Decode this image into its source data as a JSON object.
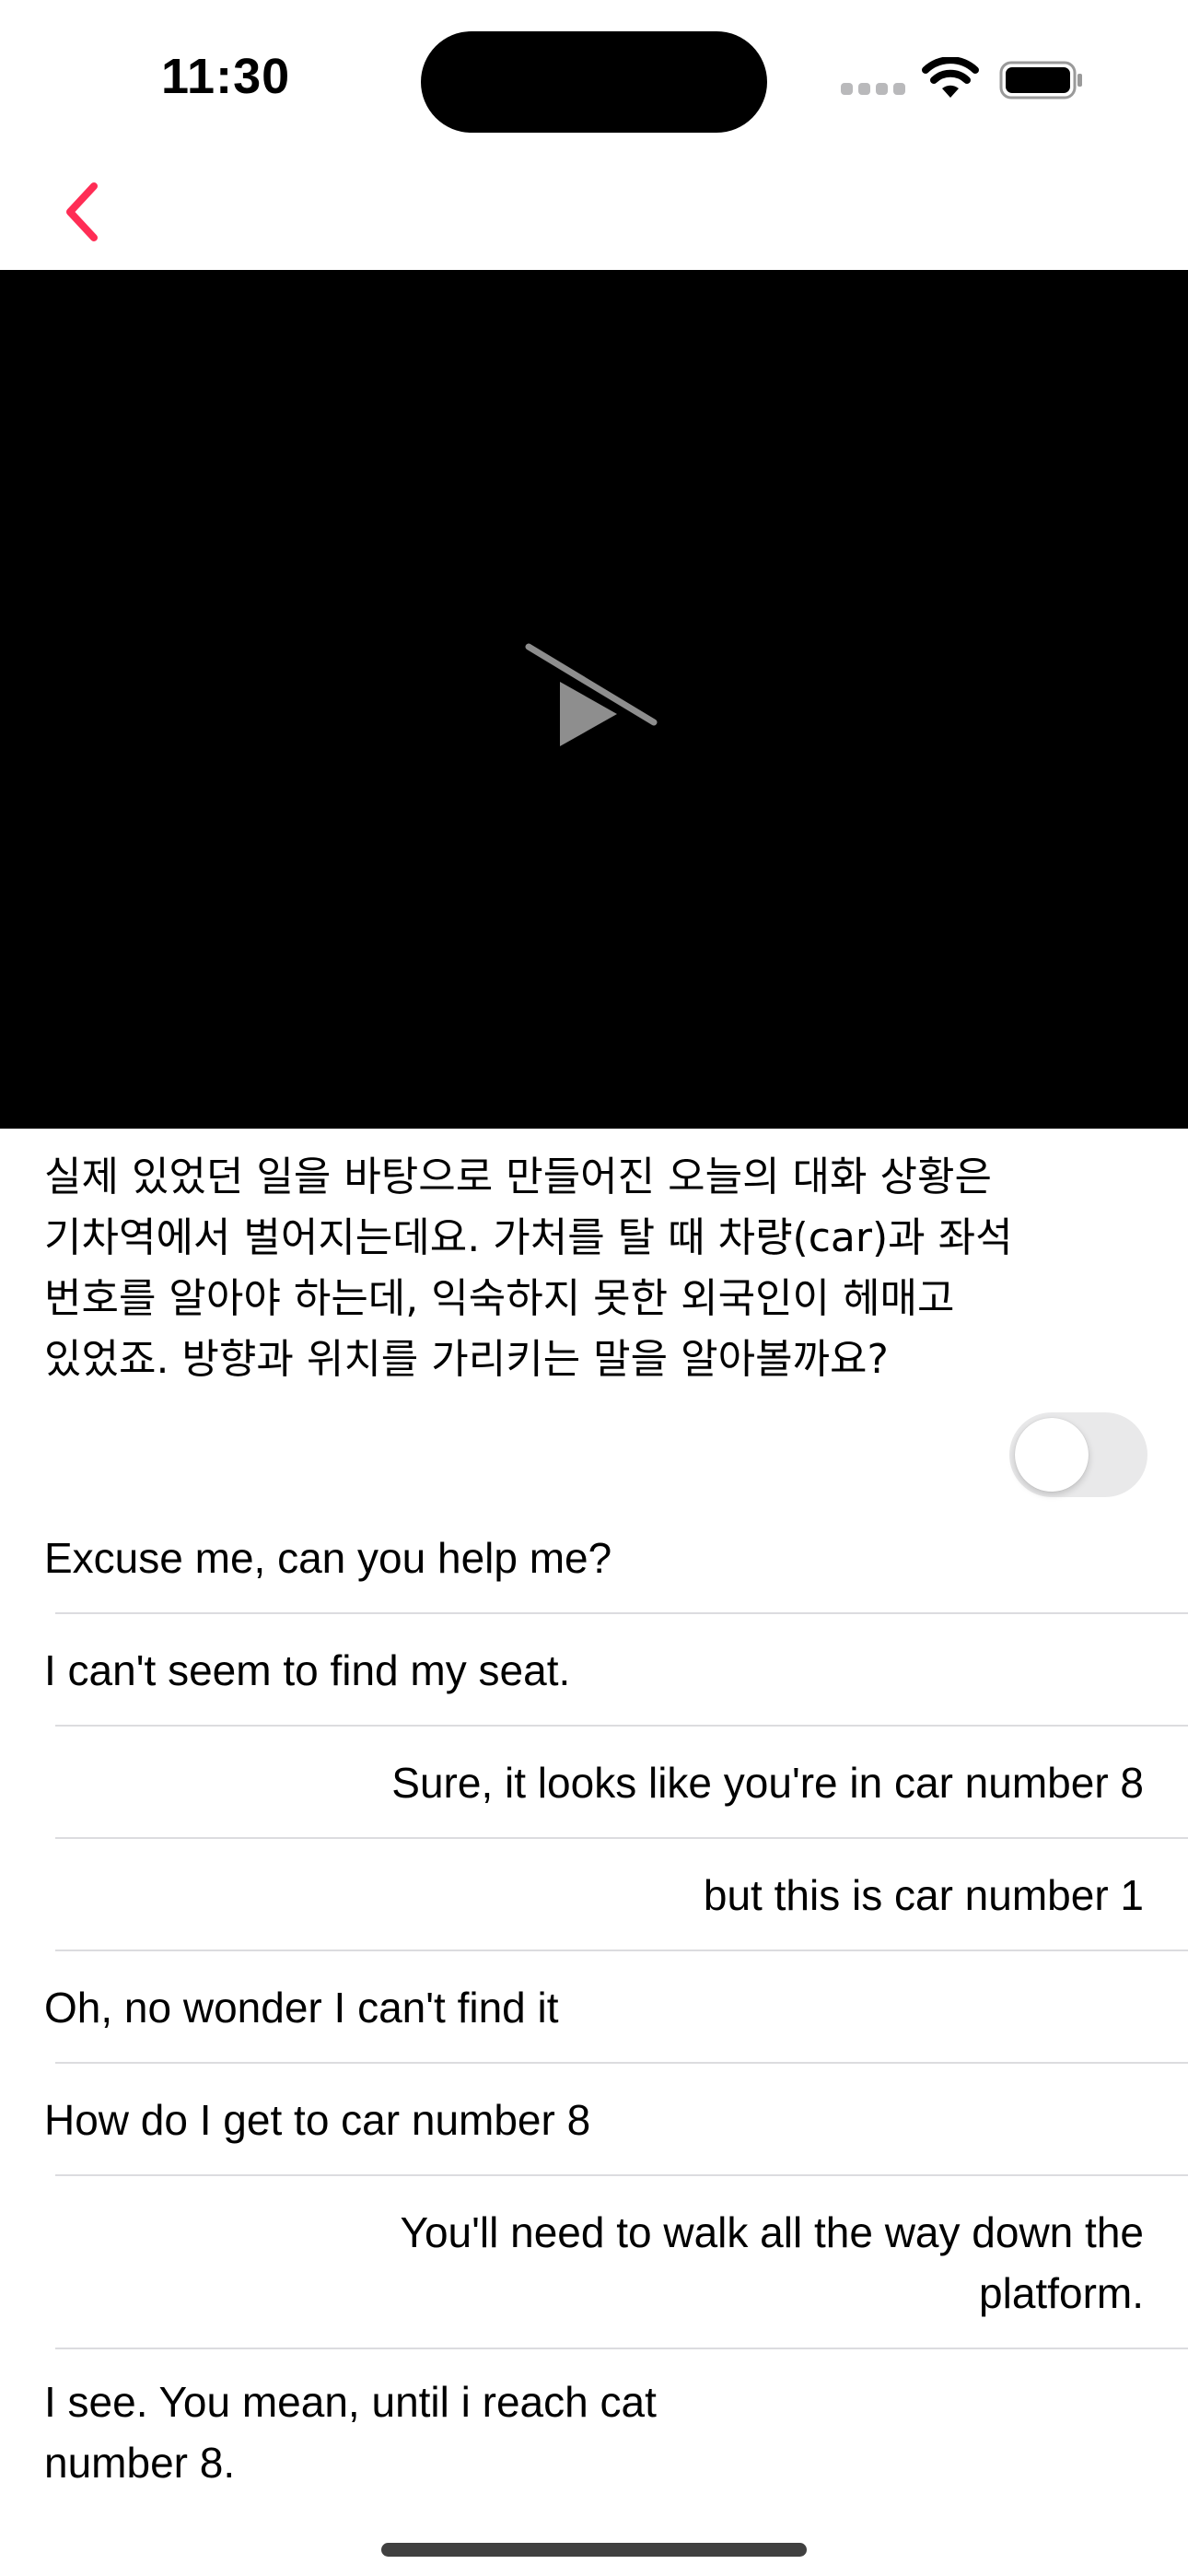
{
  "status_bar": {
    "time": "11:30",
    "signal_icon": "cellular-signal-icon",
    "wifi_icon": "wifi-icon",
    "battery_icon": "battery-icon"
  },
  "nav": {
    "back_icon": "chevron-left-icon",
    "accent_color": "#ff2d55"
  },
  "video": {
    "state_icon": "play-slash-icon"
  },
  "description_lines": [
    "실제 있었던 일을 바탕으로 만들어진 오늘의 대화 상황은",
    "기차역에서 벌어지는데요. 가처를 탈 때 차량(car)과 좌석",
    "번호를 알아야 하는데, 익숙하지 못한 외국인이 헤매고",
    "있었죠. 방향과 위치를 가리키는 말을 알아볼까요?"
  ],
  "toggle": {
    "on": false
  },
  "dialogue": [
    {
      "text": "Excuse me, can you help me?",
      "align": "left"
    },
    {
      "text": "I can't seem to find my seat.",
      "align": "left"
    },
    {
      "text": "Sure, it looks like you're in car number 8",
      "align": "right"
    },
    {
      "text": "but this is car number 1",
      "align": "right"
    },
    {
      "text": "Oh, no wonder I can't find it",
      "align": "left"
    },
    {
      "text": "How do I get to car number 8",
      "align": "left"
    },
    {
      "text": "You'll need to walk all the way down the platform.",
      "align": "right"
    },
    {
      "text": "I see. You mean, until i reach cat number 8.",
      "align": "left"
    }
  ]
}
